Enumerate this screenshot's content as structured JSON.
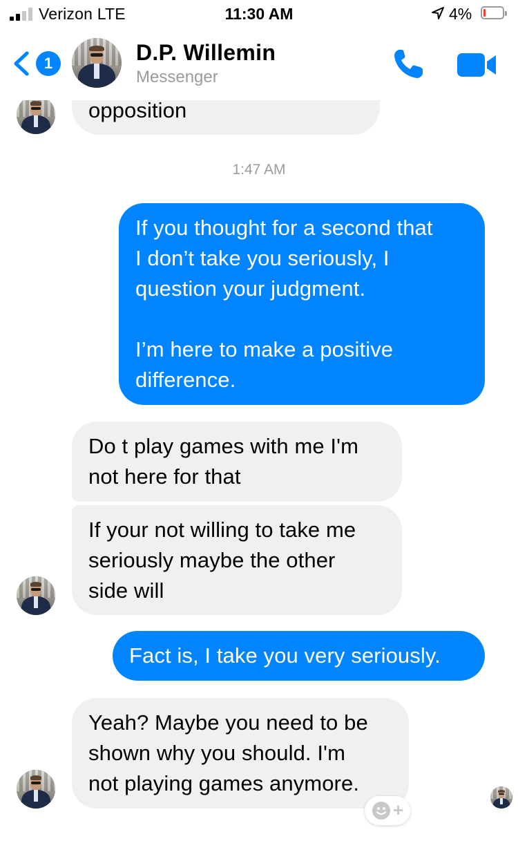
{
  "status_bar": {
    "carrier": "Verizon  LTE",
    "time": "11:30 AM",
    "battery_percent": "4%",
    "battery_level": 0.04,
    "signal_bars": 2
  },
  "header": {
    "back_count": "1",
    "contact_name": "D.P. Willemin",
    "subtitle": "Messenger",
    "accent_color": "#0084ff"
  },
  "conversation": {
    "timestamp": "1:47 AM",
    "messages": [
      {
        "sender": "them",
        "text": "opposition"
      },
      {
        "sender": "me",
        "text": "If you thought for a second that\nI don’t take you seriously, I\nquestion your judgment.\n\nI’m here to make a positive\ndifference."
      },
      {
        "sender": "them",
        "text": "Do t play games with me I'm\nnot here for that"
      },
      {
        "sender": "them",
        "text": "If your not willing to take me\nseriously maybe the other\nside will"
      },
      {
        "sender": "me",
        "text": "Fact is, I take you very seriously."
      },
      {
        "sender": "them",
        "text": "Yeah? Maybe you need to be\nshown why you should. I'm\nnot playing games anymore."
      }
    ]
  },
  "icons": {
    "back": "chevron-left-icon",
    "call": "phone-icon",
    "video": "video-camera-icon",
    "reaction": "smiley-plus-icon",
    "location": "location-arrow-icon"
  },
  "reaction_button": {
    "plus": "+"
  }
}
